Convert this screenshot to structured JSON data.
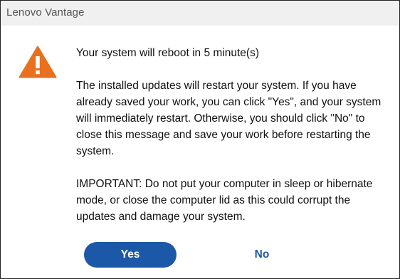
{
  "window": {
    "title": "Lenovo Vantage"
  },
  "dialog": {
    "icon": "warning-icon",
    "heading": "Your system will reboot in 5 minute(s)",
    "body": "The installed updates will restart your system. If you have already saved your work, you can click \"Yes\", and your system will immediately restart. Otherwise, you should click \"No\" to close this message and save your work before restarting the system.",
    "important": "IMPORTANT: Do not put your computer in sleep or hibernate mode, or close the computer lid as this could corrupt the updates and damage your system."
  },
  "buttons": {
    "yes_label": "Yes",
    "no_label": "No"
  },
  "colors": {
    "accent": "#1c58a8",
    "warning": "#e8701f",
    "titlebar": "#f0f0f0"
  }
}
